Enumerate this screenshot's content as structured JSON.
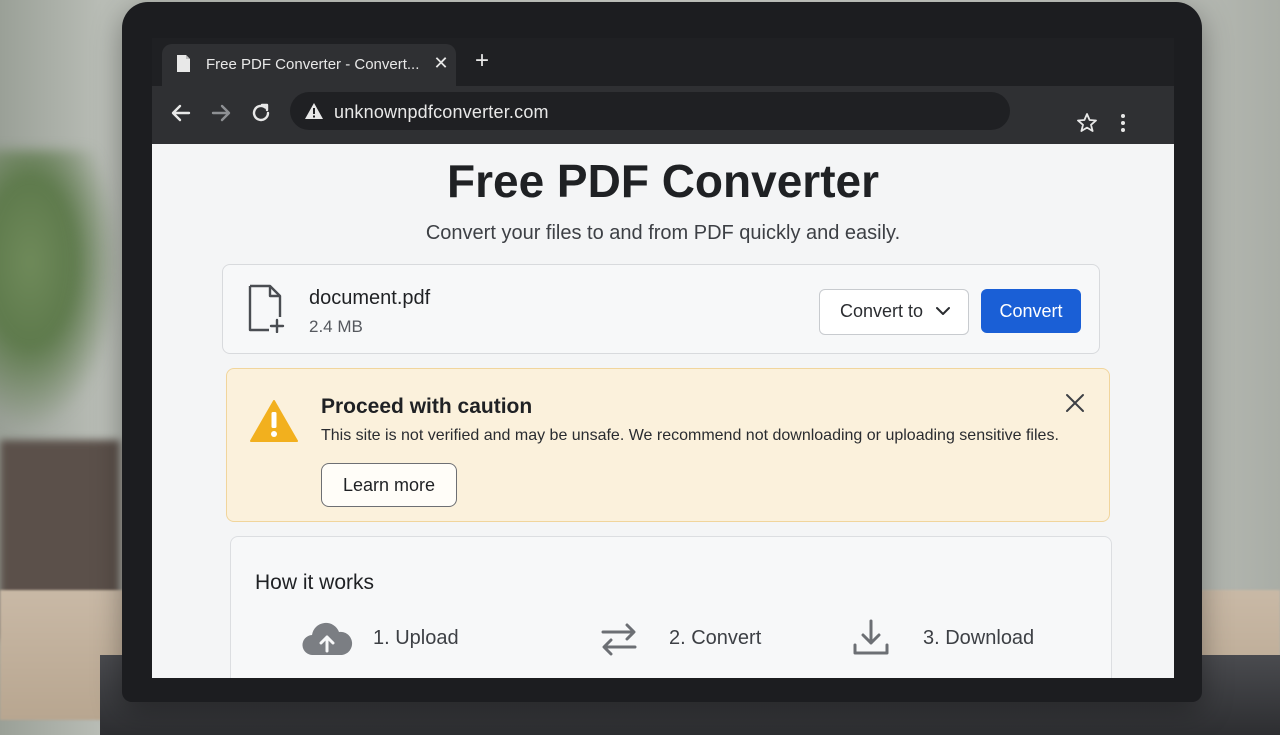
{
  "browser": {
    "tab_title": "Free PDF Converter - Convert...",
    "tab_close_symbol": "✕",
    "new_tab_symbol": "+",
    "url": "unknownpdfconverter.com",
    "icons": [
      "document-icon",
      "close-icon",
      "plus-icon",
      "back-arrow-icon",
      "forward-arrow-icon",
      "reload-icon",
      "warning-icon",
      "star-icon",
      "kebab-menu-icon"
    ]
  },
  "page": {
    "title": "Free PDF Converter",
    "subtitle": "Convert your files to and from PDF quickly and easily."
  },
  "file": {
    "name": "document.pdf",
    "size": "2.4 MB",
    "convert_to_label": "Convert to",
    "convert_button_label": "Convert"
  },
  "caution": {
    "title": "Proceed with caution",
    "message": "This site is not verified and may be unsafe. We recommend not downloading or uploading sensitive files.",
    "learn_more_label": "Learn more"
  },
  "how_it_works": {
    "title": "How it works",
    "steps": [
      {
        "label": "1. Upload",
        "icon": "cloud-upload-icon"
      },
      {
        "label": "2. Convert",
        "icon": "swap-arrows-icon"
      },
      {
        "label": "3. Download",
        "icon": "download-icon"
      }
    ]
  },
  "colors": {
    "accent_blue": "#1a5fd6",
    "warning_amber": "#f2b01e",
    "caution_bg": "#fbf1dc",
    "chrome_dark": "#1f2023"
  }
}
